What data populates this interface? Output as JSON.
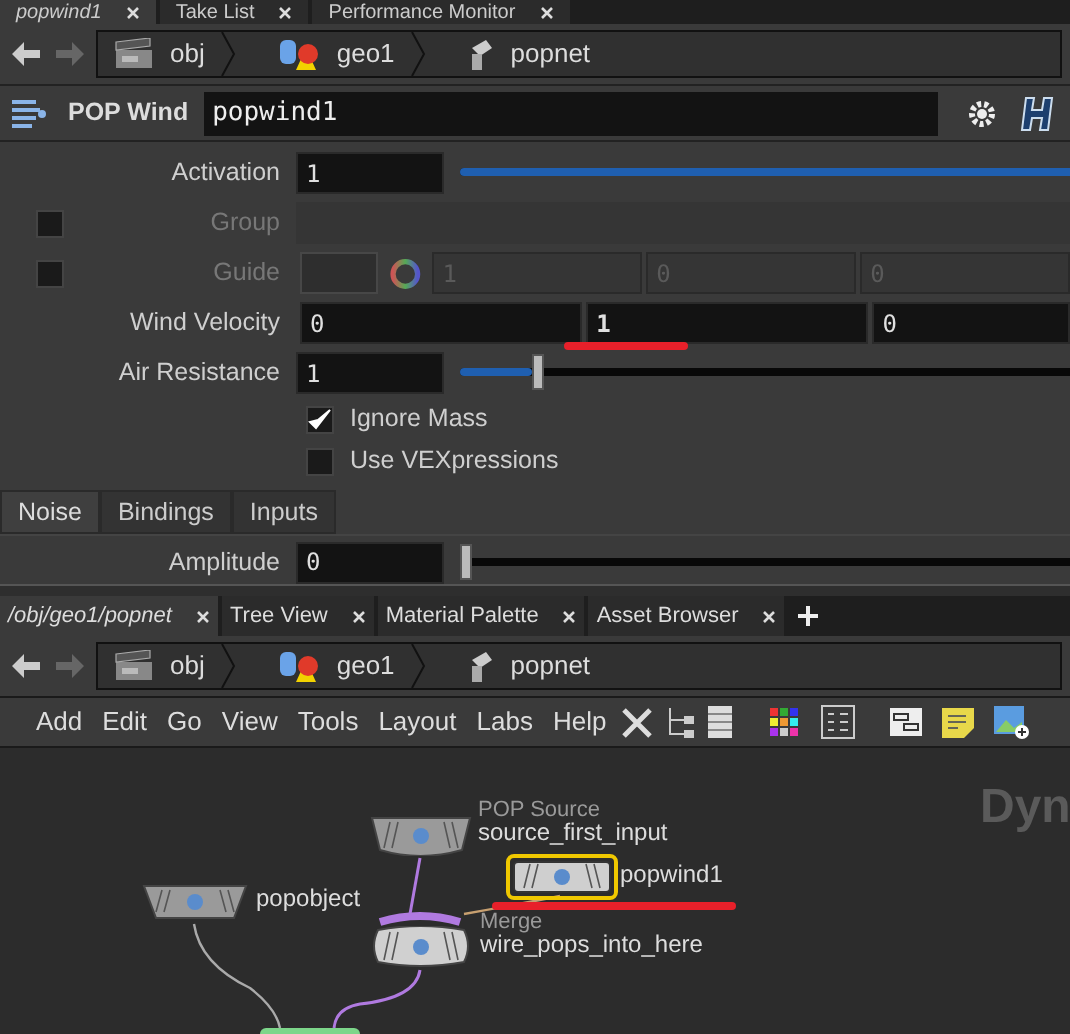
{
  "top_tabs": [
    {
      "label": "popwind1",
      "selected": true
    },
    {
      "label": "Take List",
      "selected": false
    },
    {
      "label": "Performance Monitor",
      "selected": false
    }
  ],
  "path": [
    "obj",
    "geo1",
    "popnet"
  ],
  "node_header": {
    "type": "POP Wind",
    "name": "popwind1"
  },
  "params": [
    {
      "kind": "slider",
      "label": "Activation",
      "disabled": false,
      "value": "1",
      "level": 1
    },
    {
      "kind": "text",
      "label": "Group",
      "disabled": true,
      "checked": false
    },
    {
      "kind": "color_vector",
      "label": "Guide",
      "disabled": true,
      "checked": false,
      "values": [
        {
          "text": "1",
          "changed": false
        },
        {
          "text": "0",
          "changed": false
        },
        {
          "text": "0",
          "changed": false
        }
      ]
    },
    {
      "kind": "vector",
      "label": "Wind Velocity",
      "disabled": false,
      "values": [
        {
          "text": "0",
          "changed": false
        },
        {
          "text": "1",
          "changed": true
        },
        {
          "text": "0",
          "changed": false
        }
      ]
    },
    {
      "kind": "slider",
      "label": "Air Resistance",
      "disabled": false,
      "value": "1",
      "level": 0.06
    },
    {
      "kind": "toggle",
      "label": "Ignore Mass",
      "checked": true
    },
    {
      "kind": "toggle",
      "label": "Use VEXpressions",
      "checked": false
    }
  ],
  "param_tabs": [
    {
      "label": "Noise",
      "selected": true
    },
    {
      "label": "Bindings",
      "selected": false
    },
    {
      "label": "Inputs",
      "selected": false
    }
  ],
  "noise_params": [
    {
      "kind": "slider",
      "label": "Amplitude",
      "disabled": false,
      "value": "0",
      "level": 0
    }
  ],
  "pane_tabs": [
    {
      "label": "/obj/geo1/popnet",
      "selected": true
    },
    {
      "label": "Tree View",
      "selected": false
    },
    {
      "label": "Material Palette",
      "selected": false
    },
    {
      "label": "Asset Browser",
      "selected": false
    }
  ],
  "network_path": [
    "obj",
    "geo1",
    "popnet"
  ],
  "menu": [
    "Add",
    "Edit",
    "Go",
    "View",
    "Tools",
    "Layout",
    "Labs",
    "Help"
  ],
  "network": {
    "context_label": "Dyn",
    "nodes": [
      {
        "type": "POP Source",
        "name": "source_first_input",
        "selected": false
      },
      {
        "name": "popwind1",
        "selected": true
      },
      {
        "name": "popobject",
        "selected": false
      },
      {
        "type": "Merge",
        "name": "wire_pops_into_here",
        "selected": false
      }
    ]
  }
}
